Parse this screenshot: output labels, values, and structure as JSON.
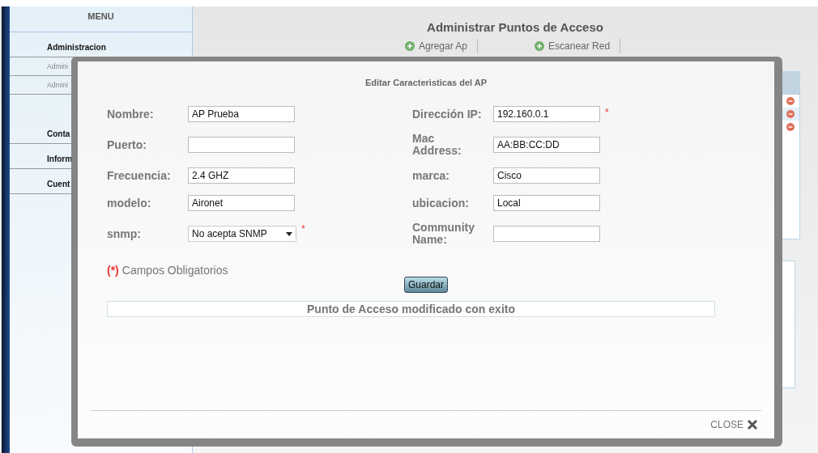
{
  "sidebar": {
    "title": "MENU",
    "items": [
      {
        "kind": "section",
        "label": "Administracion"
      },
      {
        "kind": "link",
        "label": "Admini"
      },
      {
        "kind": "link",
        "label": "Admini"
      },
      {
        "kind": "section",
        "label": "Conta"
      },
      {
        "kind": "section",
        "label": "Inform"
      },
      {
        "kind": "section",
        "label": "Cuent"
      }
    ]
  },
  "page": {
    "title": "Administrar Puntos de Acceso",
    "toolbar": [
      "Agregar Ap",
      "Escanear Red"
    ]
  },
  "modal": {
    "title": "Editar Caracteristicas del AP",
    "rows": [
      {
        "left": {
          "label": "Nombre:",
          "kind": "text",
          "value": "AP Prueba"
        },
        "right": {
          "label": "Dirección IP:",
          "kind": "text",
          "value": "192.160.0.1",
          "mark": "*"
        }
      },
      {
        "left": {
          "label": "Puerto:",
          "kind": "text"
        },
        "right": {
          "label": "Mac Address:",
          "kind": "text",
          "value": "AA:BB:CC:DD"
        }
      },
      {
        "left": {
          "label": "Frecuencia:",
          "kind": "text",
          "value": "2.4 GHZ"
        },
        "right": {
          "label": "marca:",
          "kind": "text",
          "value": "Cisco"
        }
      },
      {
        "left": {
          "label": "modelo:",
          "kind": "text",
          "value": "Aironet"
        },
        "right": {
          "label": "ubicacion:",
          "kind": "text",
          "value": "Local"
        }
      },
      {
        "left": {
          "label": "snmp:",
          "kind": "select",
          "value": "No acepta SNMP",
          "mark": "*"
        },
        "right": {
          "label": "Community Name:",
          "kind": "text"
        }
      }
    ],
    "legend_mark": "(*)",
    "legend": "Campos Obligatorios",
    "save_button": "Guardar",
    "message": "Punto de Acceso modificado con exito",
    "close": "CLOSE"
  }
}
